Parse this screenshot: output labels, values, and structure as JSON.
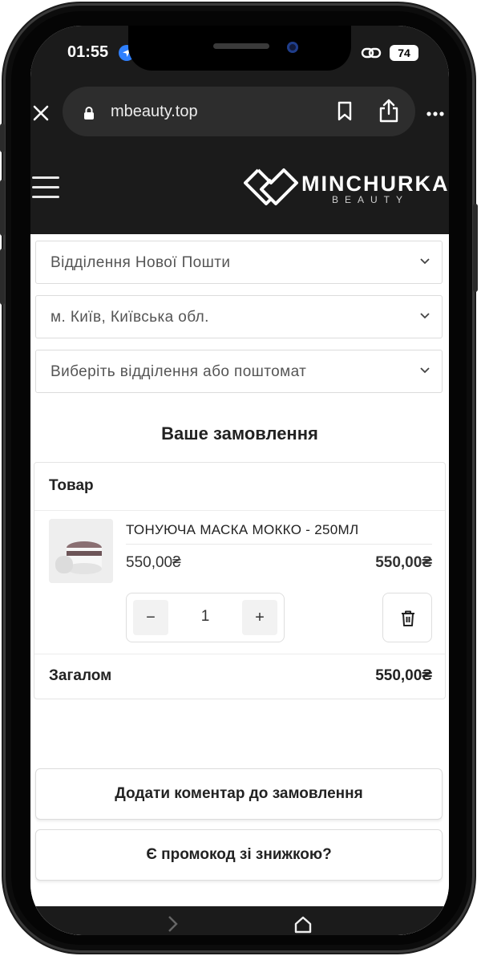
{
  "status_bar": {
    "time": "01:55",
    "battery": "74"
  },
  "browser": {
    "url": "mbeauty.top"
  },
  "site": {
    "logo_name": "MINCHURKA",
    "logo_sub": "BEAUTY"
  },
  "delivery": {
    "method": "Відділення Нової Пошти",
    "city": "м. Київ, Київська обл.",
    "branch_placeholder": "Виберіть відділення або поштомат"
  },
  "order": {
    "title": "Ваше замовлення",
    "column_header": "Товар",
    "item": {
      "name": "ТОНУЮЧА МАСКА МОККО - 250МЛ",
      "price": "550,00₴",
      "subtotal": "550,00₴",
      "quantity": "1",
      "minus": "−",
      "plus": "+"
    },
    "total_label": "Загалом",
    "total_value": "550,00₴"
  },
  "buttons": {
    "add_comment": "Додати коментар до замовлення",
    "promo": "Є промокод зі знижкою?"
  },
  "icons": {
    "location": "location-arrow-icon",
    "link": "link-icon",
    "close": "close-icon",
    "lock": "lock-icon",
    "bookmark": "bookmark-icon",
    "share": "share-icon",
    "more": "more-icon",
    "menu": "hamburger-menu-icon",
    "chevron": "chevron-down-icon",
    "trash": "trash-icon",
    "forward": "chevron-right-icon",
    "home": "home-icon"
  },
  "colors": {
    "header_bg": "#1b1b1b",
    "location_blue": "#2f80ff"
  }
}
